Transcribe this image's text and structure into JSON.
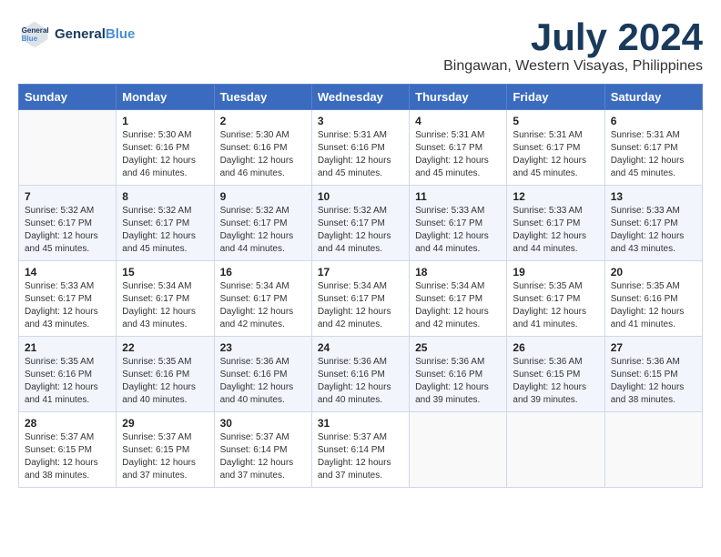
{
  "header": {
    "logo_line1": "General",
    "logo_line2": "Blue",
    "month_year": "July 2024",
    "location": "Bingawan, Western Visayas, Philippines"
  },
  "weekdays": [
    "Sunday",
    "Monday",
    "Tuesday",
    "Wednesday",
    "Thursday",
    "Friday",
    "Saturday"
  ],
  "weeks": [
    [
      {
        "day": "",
        "sunrise": "",
        "sunset": "",
        "daylight": ""
      },
      {
        "day": "1",
        "sunrise": "Sunrise: 5:30 AM",
        "sunset": "Sunset: 6:16 PM",
        "daylight": "Daylight: 12 hours and 46 minutes."
      },
      {
        "day": "2",
        "sunrise": "Sunrise: 5:30 AM",
        "sunset": "Sunset: 6:16 PM",
        "daylight": "Daylight: 12 hours and 46 minutes."
      },
      {
        "day": "3",
        "sunrise": "Sunrise: 5:31 AM",
        "sunset": "Sunset: 6:16 PM",
        "daylight": "Daylight: 12 hours and 45 minutes."
      },
      {
        "day": "4",
        "sunrise": "Sunrise: 5:31 AM",
        "sunset": "Sunset: 6:17 PM",
        "daylight": "Daylight: 12 hours and 45 minutes."
      },
      {
        "day": "5",
        "sunrise": "Sunrise: 5:31 AM",
        "sunset": "Sunset: 6:17 PM",
        "daylight": "Daylight: 12 hours and 45 minutes."
      },
      {
        "day": "6",
        "sunrise": "Sunrise: 5:31 AM",
        "sunset": "Sunset: 6:17 PM",
        "daylight": "Daylight: 12 hours and 45 minutes."
      }
    ],
    [
      {
        "day": "7",
        "sunrise": "Sunrise: 5:32 AM",
        "sunset": "Sunset: 6:17 PM",
        "daylight": "Daylight: 12 hours and 45 minutes."
      },
      {
        "day": "8",
        "sunrise": "Sunrise: 5:32 AM",
        "sunset": "Sunset: 6:17 PM",
        "daylight": "Daylight: 12 hours and 45 minutes."
      },
      {
        "day": "9",
        "sunrise": "Sunrise: 5:32 AM",
        "sunset": "Sunset: 6:17 PM",
        "daylight": "Daylight: 12 hours and 44 minutes."
      },
      {
        "day": "10",
        "sunrise": "Sunrise: 5:32 AM",
        "sunset": "Sunset: 6:17 PM",
        "daylight": "Daylight: 12 hours and 44 minutes."
      },
      {
        "day": "11",
        "sunrise": "Sunrise: 5:33 AM",
        "sunset": "Sunset: 6:17 PM",
        "daylight": "Daylight: 12 hours and 44 minutes."
      },
      {
        "day": "12",
        "sunrise": "Sunrise: 5:33 AM",
        "sunset": "Sunset: 6:17 PM",
        "daylight": "Daylight: 12 hours and 44 minutes."
      },
      {
        "day": "13",
        "sunrise": "Sunrise: 5:33 AM",
        "sunset": "Sunset: 6:17 PM",
        "daylight": "Daylight: 12 hours and 43 minutes."
      }
    ],
    [
      {
        "day": "14",
        "sunrise": "Sunrise: 5:33 AM",
        "sunset": "Sunset: 6:17 PM",
        "daylight": "Daylight: 12 hours and 43 minutes."
      },
      {
        "day": "15",
        "sunrise": "Sunrise: 5:34 AM",
        "sunset": "Sunset: 6:17 PM",
        "daylight": "Daylight: 12 hours and 43 minutes."
      },
      {
        "day": "16",
        "sunrise": "Sunrise: 5:34 AM",
        "sunset": "Sunset: 6:17 PM",
        "daylight": "Daylight: 12 hours and 42 minutes."
      },
      {
        "day": "17",
        "sunrise": "Sunrise: 5:34 AM",
        "sunset": "Sunset: 6:17 PM",
        "daylight": "Daylight: 12 hours and 42 minutes."
      },
      {
        "day": "18",
        "sunrise": "Sunrise: 5:34 AM",
        "sunset": "Sunset: 6:17 PM",
        "daylight": "Daylight: 12 hours and 42 minutes."
      },
      {
        "day": "19",
        "sunrise": "Sunrise: 5:35 AM",
        "sunset": "Sunset: 6:17 PM",
        "daylight": "Daylight: 12 hours and 41 minutes."
      },
      {
        "day": "20",
        "sunrise": "Sunrise: 5:35 AM",
        "sunset": "Sunset: 6:16 PM",
        "daylight": "Daylight: 12 hours and 41 minutes."
      }
    ],
    [
      {
        "day": "21",
        "sunrise": "Sunrise: 5:35 AM",
        "sunset": "Sunset: 6:16 PM",
        "daylight": "Daylight: 12 hours and 41 minutes."
      },
      {
        "day": "22",
        "sunrise": "Sunrise: 5:35 AM",
        "sunset": "Sunset: 6:16 PM",
        "daylight": "Daylight: 12 hours and 40 minutes."
      },
      {
        "day": "23",
        "sunrise": "Sunrise: 5:36 AM",
        "sunset": "Sunset: 6:16 PM",
        "daylight": "Daylight: 12 hours and 40 minutes."
      },
      {
        "day": "24",
        "sunrise": "Sunrise: 5:36 AM",
        "sunset": "Sunset: 6:16 PM",
        "daylight": "Daylight: 12 hours and 40 minutes."
      },
      {
        "day": "25",
        "sunrise": "Sunrise: 5:36 AM",
        "sunset": "Sunset: 6:16 PM",
        "daylight": "Daylight: 12 hours and 39 minutes."
      },
      {
        "day": "26",
        "sunrise": "Sunrise: 5:36 AM",
        "sunset": "Sunset: 6:15 PM",
        "daylight": "Daylight: 12 hours and 39 minutes."
      },
      {
        "day": "27",
        "sunrise": "Sunrise: 5:36 AM",
        "sunset": "Sunset: 6:15 PM",
        "daylight": "Daylight: 12 hours and 38 minutes."
      }
    ],
    [
      {
        "day": "28",
        "sunrise": "Sunrise: 5:37 AM",
        "sunset": "Sunset: 6:15 PM",
        "daylight": "Daylight: 12 hours and 38 minutes."
      },
      {
        "day": "29",
        "sunrise": "Sunrise: 5:37 AM",
        "sunset": "Sunset: 6:15 PM",
        "daylight": "Daylight: 12 hours and 37 minutes."
      },
      {
        "day": "30",
        "sunrise": "Sunrise: 5:37 AM",
        "sunset": "Sunset: 6:14 PM",
        "daylight": "Daylight: 12 hours and 37 minutes."
      },
      {
        "day": "31",
        "sunrise": "Sunrise: 5:37 AM",
        "sunset": "Sunset: 6:14 PM",
        "daylight": "Daylight: 12 hours and 37 minutes."
      },
      {
        "day": "",
        "sunrise": "",
        "sunset": "",
        "daylight": ""
      },
      {
        "day": "",
        "sunrise": "",
        "sunset": "",
        "daylight": ""
      },
      {
        "day": "",
        "sunrise": "",
        "sunset": "",
        "daylight": ""
      }
    ]
  ]
}
